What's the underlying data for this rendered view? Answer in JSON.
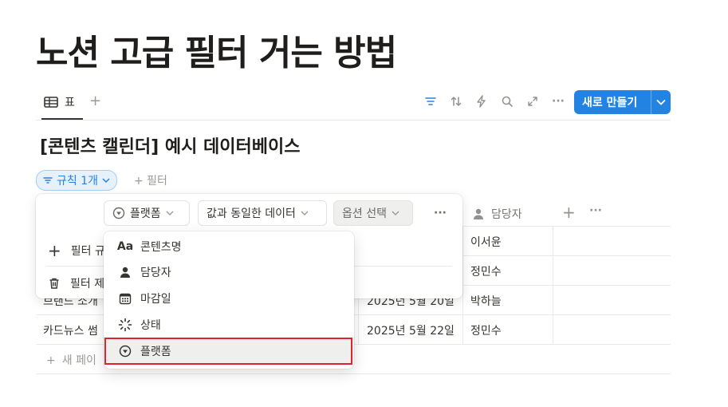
{
  "page": {
    "title": "노션 고급 필터 거는 방법"
  },
  "view": {
    "tab_label": "표",
    "add_icon": "plus-icon"
  },
  "toolbar": {
    "icons": [
      "filter-icon",
      "sort-icon",
      "automation-icon",
      "search-icon",
      "expand-icon",
      "more-icon"
    ],
    "new_button_label": "새로 만들기",
    "accent": "#2383e2"
  },
  "database": {
    "title": "[콘텐츠 캘린더] 예시 데이터베이스"
  },
  "filter_bar": {
    "rule_pill": "규칙 1개",
    "add_filter": "+ 필터"
  },
  "table": {
    "header_assignee": "담당자",
    "rows": [
      {
        "name": "",
        "date": "",
        "assignee": "이서윤"
      },
      {
        "name": "",
        "date": "",
        "assignee": "정민수"
      },
      {
        "name": "브랜드 소개",
        "date": "2025년 5월 20일",
        "assignee": "박하늘"
      },
      {
        "name": "카드뉴스 썸",
        "date": "2025년 5월 22일",
        "assignee": "정민수"
      }
    ],
    "new_page": "새 페이"
  },
  "filter_panel": {
    "property_chip": "플랫폼",
    "condition_chip": "값과 동일한 데이터",
    "option_chip": "옵션 선택",
    "add_rule": "필터 규",
    "delete_filter": "필터 제"
  },
  "dropdown": {
    "items": [
      {
        "icon": "text-aa-icon",
        "glyph": "Aa",
        "label": "콘텐츠명"
      },
      {
        "icon": "person-icon",
        "label": "담당자"
      },
      {
        "icon": "calendar-icon",
        "label": "마감일"
      },
      {
        "icon": "status-icon",
        "label": "상태"
      },
      {
        "icon": "select-circle-icon",
        "label": "플랫폼"
      }
    ],
    "highlight_color": "#e0222c"
  }
}
